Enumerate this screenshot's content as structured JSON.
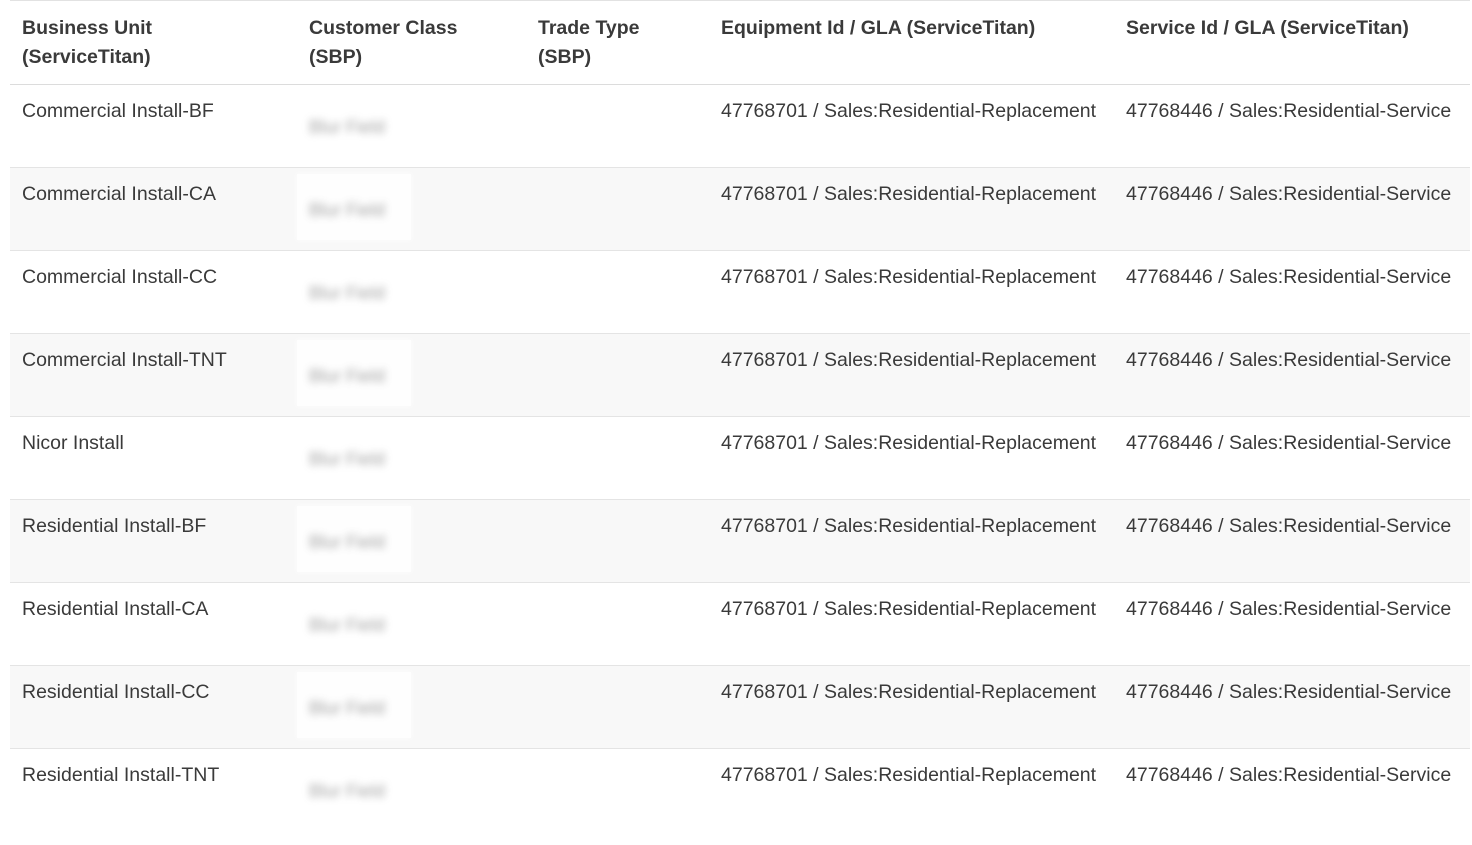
{
  "headers": [
    "Business Unit (ServiceTitan)",
    "Customer Class (SBP)",
    "Trade Type (SBP)",
    "Equipment Id / GLA (ServiceTitan)",
    "Service Id / GLA (ServiceTitan)"
  ],
  "rows": [
    {
      "business_unit": "Commercial Install-BF",
      "customer_class": "Blur Field",
      "trade_type": "",
      "equipment": "47768701 / Sales:Residential-Replacement",
      "service": "47768446 / Sales:Residential-Service"
    },
    {
      "business_unit": "Commercial Install-CA",
      "customer_class": "Blur Field",
      "trade_type": "",
      "equipment": "47768701 / Sales:Residential-Replacement",
      "service": "47768446 / Sales:Residential-Service"
    },
    {
      "business_unit": "Commercial Install-CC",
      "customer_class": "Blur Field",
      "trade_type": "",
      "equipment": "47768701 / Sales:Residential-Replacement",
      "service": "47768446 / Sales:Residential-Service"
    },
    {
      "business_unit": "Commercial Install-TNT",
      "customer_class": "Blur Field",
      "trade_type": "",
      "equipment": "47768701 / Sales:Residential-Replacement",
      "service": "47768446 / Sales:Residential-Service"
    },
    {
      "business_unit": "Nicor Install",
      "customer_class": "Blur Field",
      "trade_type": "",
      "equipment": "47768701 / Sales:Residential-Replacement",
      "service": "47768446 / Sales:Residential-Service"
    },
    {
      "business_unit": "Residential Install-BF",
      "customer_class": "Blur Field",
      "trade_type": "",
      "equipment": "47768701 / Sales:Residential-Replacement",
      "service": "47768446 / Sales:Residential-Service"
    },
    {
      "business_unit": "Residential Install-CA",
      "customer_class": "Blur Field",
      "trade_type": "",
      "equipment": "47768701 / Sales:Residential-Replacement",
      "service": "47768446 / Sales:Residential-Service"
    },
    {
      "business_unit": "Residential Install-CC",
      "customer_class": "Blur Field",
      "trade_type": "",
      "equipment": "47768701 / Sales:Residential-Replacement",
      "service": "47768446 / Sales:Residential-Service"
    },
    {
      "business_unit": "Residential Install-TNT",
      "customer_class": "Blur Field",
      "trade_type": "",
      "equipment": "47768701 / Sales:Residential-Replacement",
      "service": "47768446 / Sales:Residential-Service"
    }
  ]
}
